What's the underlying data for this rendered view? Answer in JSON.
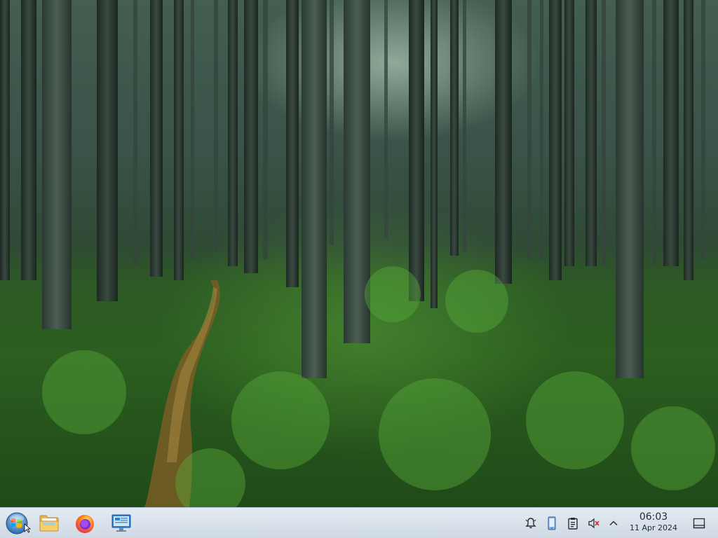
{
  "taskbar": {
    "start_icon": "windows-orb-icon",
    "pinned": [
      {
        "name": "file-manager",
        "icon": "folder-icon"
      },
      {
        "name": "firefox",
        "icon": "firefox-icon"
      },
      {
        "name": "remote-desktop",
        "icon": "monitor-icon"
      }
    ],
    "tray": [
      {
        "name": "notifications",
        "icon": "bell-icon"
      },
      {
        "name": "clipboard-app",
        "icon": "phone-icon"
      },
      {
        "name": "clipboard",
        "icon": "clipboard-icon"
      },
      {
        "name": "volume",
        "icon": "speaker-muted-icon"
      },
      {
        "name": "show-hidden",
        "icon": "chevron-up-icon"
      }
    ],
    "clock": {
      "time": "06:03",
      "date": "11 Apr 2024"
    },
    "show_desktop_icon": "show-desktop-icon"
  },
  "colors": {
    "taskbar_top": "#e4ebf2",
    "taskbar_bottom": "#cfd9e3",
    "forest_floor": "#2b5e1f",
    "path": "#8a6a2c"
  }
}
